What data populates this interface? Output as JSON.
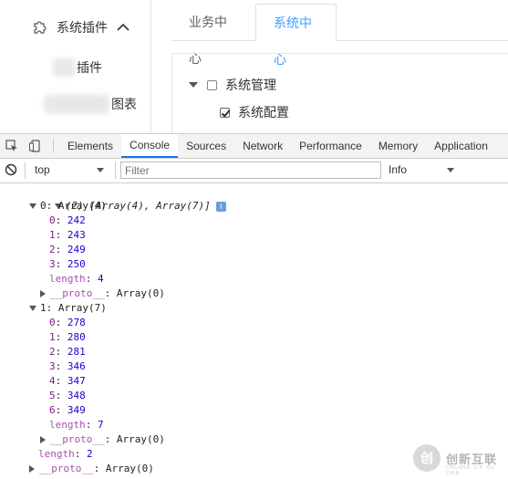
{
  "sidebar": {
    "section_label": "系统插件",
    "items": [
      {
        "label": "插件"
      },
      {
        "label": "图表"
      }
    ]
  },
  "main": {
    "tabs": [
      {
        "label": "业务中心",
        "active": false
      },
      {
        "label": "系统中心",
        "active": true
      }
    ],
    "tree": [
      {
        "label": "系统管理",
        "checked": false,
        "expanded": true
      },
      {
        "label": "系统配置",
        "checked": true
      }
    ]
  },
  "devtools": {
    "tabs": [
      "Elements",
      "Console",
      "Sources",
      "Network",
      "Performance",
      "Memory",
      "Application"
    ],
    "active_tab": "Console",
    "context": "top",
    "filter_placeholder": "Filter",
    "level": "Info",
    "accent_color": "#1a73e8"
  },
  "console": {
    "summary": "(2) [Array(4), Array(7)]",
    "info_badge": "i",
    "arrays": [
      {
        "header": "0: Array(4)",
        "items": [
          {
            "idx": "0",
            "val": "242"
          },
          {
            "idx": "1",
            "val": "243"
          },
          {
            "idx": "2",
            "val": "249"
          },
          {
            "idx": "3",
            "val": "250"
          }
        ],
        "length_label": "length",
        "length": "4",
        "proto_label": "__proto__",
        "proto_val": "Array(0)"
      },
      {
        "header": "1: Array(7)",
        "items": [
          {
            "idx": "0",
            "val": "278"
          },
          {
            "idx": "1",
            "val": "280"
          },
          {
            "idx": "2",
            "val": "281"
          },
          {
            "idx": "3",
            "val": "346"
          },
          {
            "idx": "4",
            "val": "347"
          },
          {
            "idx": "5",
            "val": "348"
          },
          {
            "idx": "6",
            "val": "349"
          }
        ],
        "length_label": "length",
        "length": "7",
        "proto_label": "__proto__",
        "proto_val": "Array(0)"
      }
    ],
    "outer_length_label": "length",
    "outer_length": "2",
    "outer_proto_label": "__proto__",
    "outer_proto_val": "Array(0)"
  },
  "watermark": {
    "logo_char": "创",
    "text": "创新互联",
    "sub": "CHUANG XIN HU LIAN"
  }
}
